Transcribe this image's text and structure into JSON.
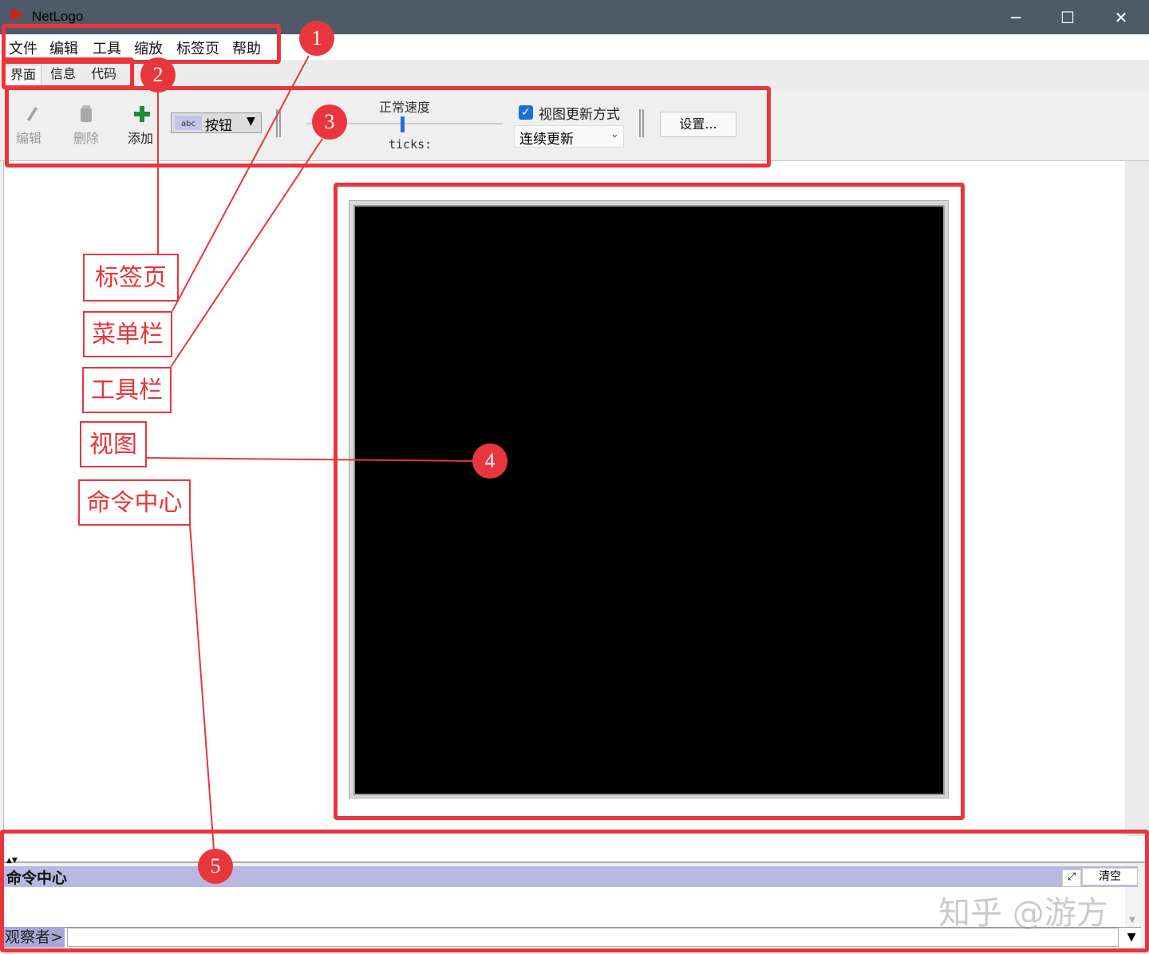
{
  "window": {
    "title": "NetLogo",
    "minimize_icon": "─",
    "maximize_icon": "☐",
    "close_icon": "✕"
  },
  "menubar": {
    "items": [
      "文件",
      "编辑",
      "工具",
      "缩放",
      "标签页",
      "帮助"
    ]
  },
  "tabs": [
    "界面",
    "信息",
    "代码"
  ],
  "toolbar": {
    "edit_label": "编辑",
    "delete_label": "删除",
    "add_label": "添加",
    "widget_icon_text": "abc",
    "widget_select_value": "按钮",
    "speed_label": "正常速度",
    "ticks_label": "ticks:",
    "view_updates_label": "视图更新方式",
    "view_updates_checked": true,
    "update_mode_value": "连续更新",
    "settings_label": "设置..."
  },
  "command_center": {
    "title": "命令中心",
    "clear_label": "清空",
    "agent_prompt": "观察者>",
    "input_value": ""
  },
  "watermark": "知乎 @游方",
  "annotations": {
    "badges": [
      "1",
      "2",
      "3",
      "4",
      "5"
    ],
    "callouts": [
      "标签页",
      "菜单栏",
      "工具栏",
      "视图",
      "命令中心"
    ],
    "color": "#e8363c"
  },
  "colors": {
    "titlebar": "#4f5a68",
    "cc_header": "#b8b8e0",
    "view_background": "#000000",
    "accent": "#1f6fd6"
  }
}
